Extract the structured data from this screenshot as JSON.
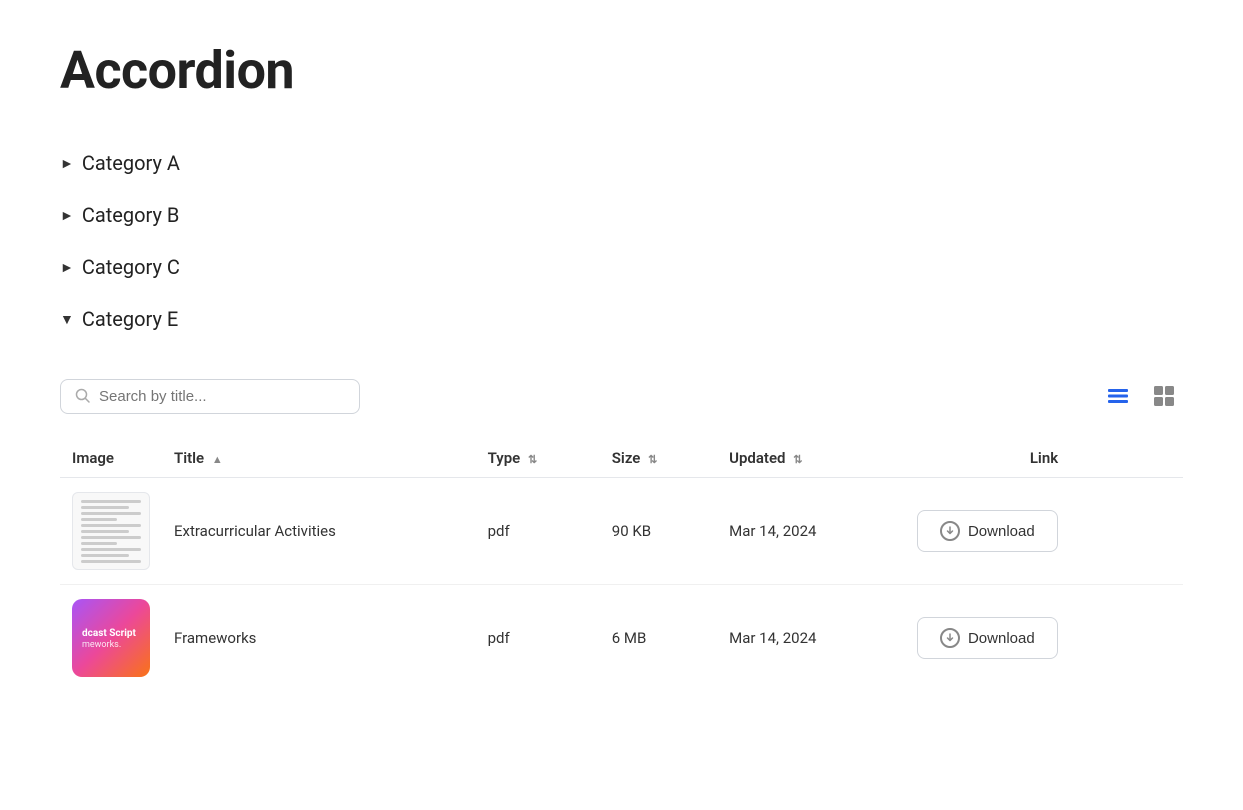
{
  "page": {
    "title": "Accordion"
  },
  "accordion": {
    "items": [
      {
        "label": "Category A",
        "expanded": false,
        "arrow": "►"
      },
      {
        "label": "Category B",
        "expanded": false,
        "arrow": "►"
      },
      {
        "label": "Category C",
        "expanded": false,
        "arrow": "►"
      },
      {
        "label": "Category E",
        "expanded": true,
        "arrow": "▼"
      }
    ]
  },
  "search": {
    "placeholder": "Search by title..."
  },
  "table": {
    "columns": [
      {
        "key": "image",
        "label": "Image",
        "sortable": false
      },
      {
        "key": "title",
        "label": "Title",
        "sortable": true,
        "sortDir": "asc"
      },
      {
        "key": "type",
        "label": "Type",
        "sortable": true
      },
      {
        "key": "size",
        "label": "Size",
        "sortable": true
      },
      {
        "key": "updated",
        "label": "Updated",
        "sortable": true
      },
      {
        "key": "link",
        "label": "Link",
        "sortable": false
      }
    ],
    "rows": [
      {
        "id": 1,
        "thumbType": "doc",
        "title": "Extracurricular Activities",
        "type": "pdf",
        "size": "90 KB",
        "updated": "Mar 14, 2024",
        "linkLabel": "Download"
      },
      {
        "id": 2,
        "thumbType": "gradient",
        "gradientText1": "dcast Script",
        "gradientText2": "meworks.",
        "title": "Frameworks",
        "type": "pdf",
        "size": "6 MB",
        "updated": "Mar 14, 2024",
        "linkLabel": "Download"
      }
    ]
  },
  "icons": {
    "listView": "list-view-icon",
    "gridView": "grid-view-icon",
    "search": "search-icon",
    "download": "download-icon"
  }
}
